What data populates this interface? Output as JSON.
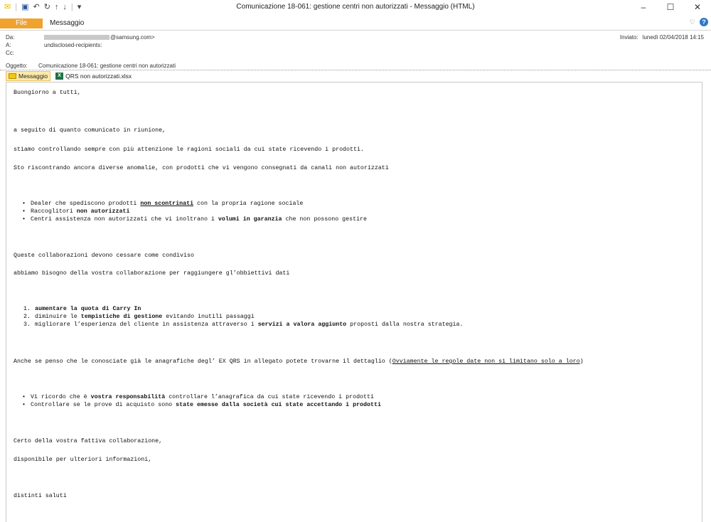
{
  "window": {
    "title": "Comunicazione 18-061: gestione centri non autorizzati  -  Messaggio (HTML)",
    "minimize": "–",
    "maximize": "☐",
    "close": "✕"
  },
  "ribbon": {
    "file_tab": "File",
    "message_tab": "Messaggio"
  },
  "header": {
    "from_label": "Da:",
    "from_value_visible": "@samsung.com>",
    "to_label": "A:",
    "to_value": "undisclosed-recipients:",
    "cc_label": "Cc:",
    "cc_value": "",
    "subject_label": "Oggetto:",
    "subject_value": "Comunicazione 18-061: gestione centri non autorizzati",
    "sent_label": "Inviato:",
    "sent_value": "lunedì 02/04/2018 14:15"
  },
  "attachments": {
    "message_label": "Messaggio",
    "file_name": "QRS non autorizzati.xlsx"
  },
  "body": {
    "greeting": "Buongiorno a tutti,",
    "p1": "a seguito di quanto comunicato in riunione,",
    "p2": "stiamo controllando sempre con più attenzione le ragioni sociali da cui state ricevendo i prodotti.",
    "p3": "Sto riscontrando ancora diverse anomalie, con prodotti che vi vengono consegnati da canali non autorizzati",
    "b1_a": "Dealer che spediscono prodotti ",
    "b1_b": "non scontrinati",
    "b1_c": " con la propria ragione sociale",
    "b2_a": "Raccoglitori ",
    "b2_b": "non autorizzati",
    "b3_a": "Centri assistenza non autorizzati che vi inoltrano i ",
    "b3_b": "volumi in garanzia",
    "b3_c": " che non possono gestire",
    "p4": "Queste collaborazioni devono cessare come condiviso",
    "p5": "abbiamo bisogno della vostra collaborazione per raggiungere gl’obbiettivi dati",
    "n1_num": "1.",
    "n1": "aumentare la quota di Carry In",
    "n2_num": "2.",
    "n2_a": "diminuire le ",
    "n2_b": "tempistiche di gestione",
    "n2_c": " evitando inutili passaggi",
    "n3_num": "3.",
    "n3_a": "migliorare l’esperienza  del cliente in assistenza attraverso i ",
    "n3_b": "servizi a valora aggiunto",
    "n3_c": " proposti dalla nostra strategia.",
    "p6_a": "Anche se penso che le conosciate già le anagrafiche degl’ EX QRS  in allegato potete trovarne il dettaglio (",
    "p6_b": "Ovviamente le regole date non si limitano solo a loro",
    "p6_c": ")",
    "b4_a": "Vi ricordo che è ",
    "b4_b": "vostra responsabilità",
    "b4_c": " controllare l’anagrafica da cui state ricevendo i prodotti",
    "b5_a": "Controllare se le prove di acquisto sono ",
    "b5_b": "state emesse dalla società cui state accettando i prodotti",
    "p7": "Certo della vostra fattiva collaborazione,",
    "p8": "disponibile per ulteriori informazioni,",
    "p9": "distinti saluti"
  }
}
